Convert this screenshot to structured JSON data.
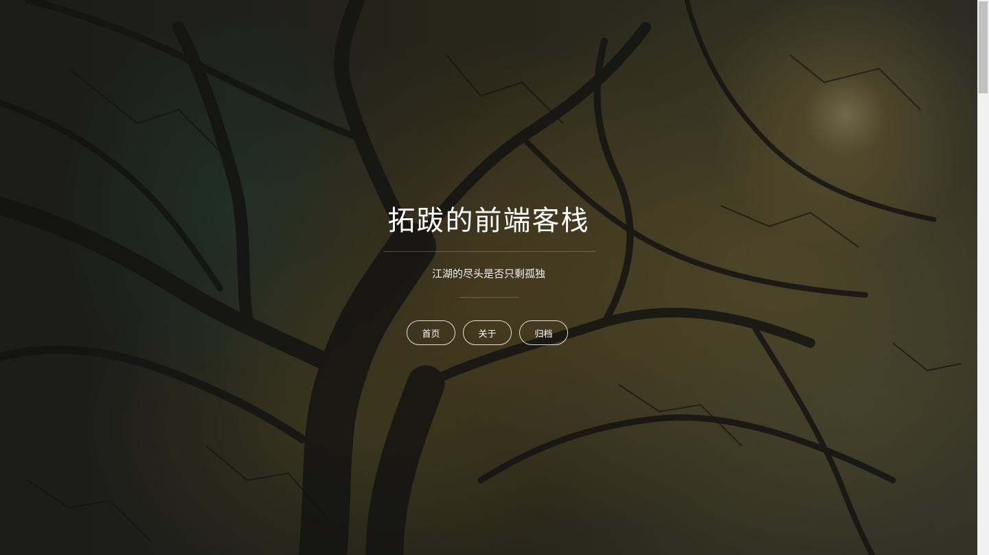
{
  "site": {
    "title": "拓跋的前端客栈",
    "subtitle": "江湖的尽头是否只剩孤独"
  },
  "nav": {
    "items": [
      {
        "label": "首页"
      },
      {
        "label": "关于"
      },
      {
        "label": "归档"
      }
    ]
  },
  "background": {
    "icon": "forest-canopy-photo",
    "colors": {
      "dark": "#1e1e1c",
      "foliage": "#6b5a28",
      "sunlight": "#e6d296"
    }
  }
}
